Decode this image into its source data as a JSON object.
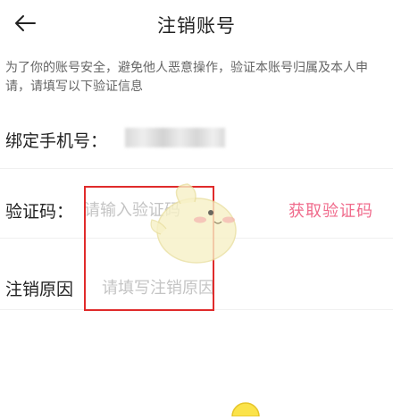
{
  "header": {
    "title": "注销账号",
    "back_icon": "back-arrow-icon"
  },
  "notice": "为了你的账号安全，避免他人恶意操作，验证本账号归属及本人申请，请填写以下验证信息",
  "phone": {
    "label": "绑定手机号：",
    "value_masked": true
  },
  "code": {
    "label": "验证码：",
    "placeholder": "请输入验证码",
    "value": "",
    "get_code_label": "获取验证码"
  },
  "reason": {
    "label": "注销原因",
    "placeholder": "请填写注销原因",
    "value": ""
  },
  "colors": {
    "accent": "#f06b8c",
    "highlight_border": "#e02b2b",
    "placeholder": "#c4c4c4"
  }
}
